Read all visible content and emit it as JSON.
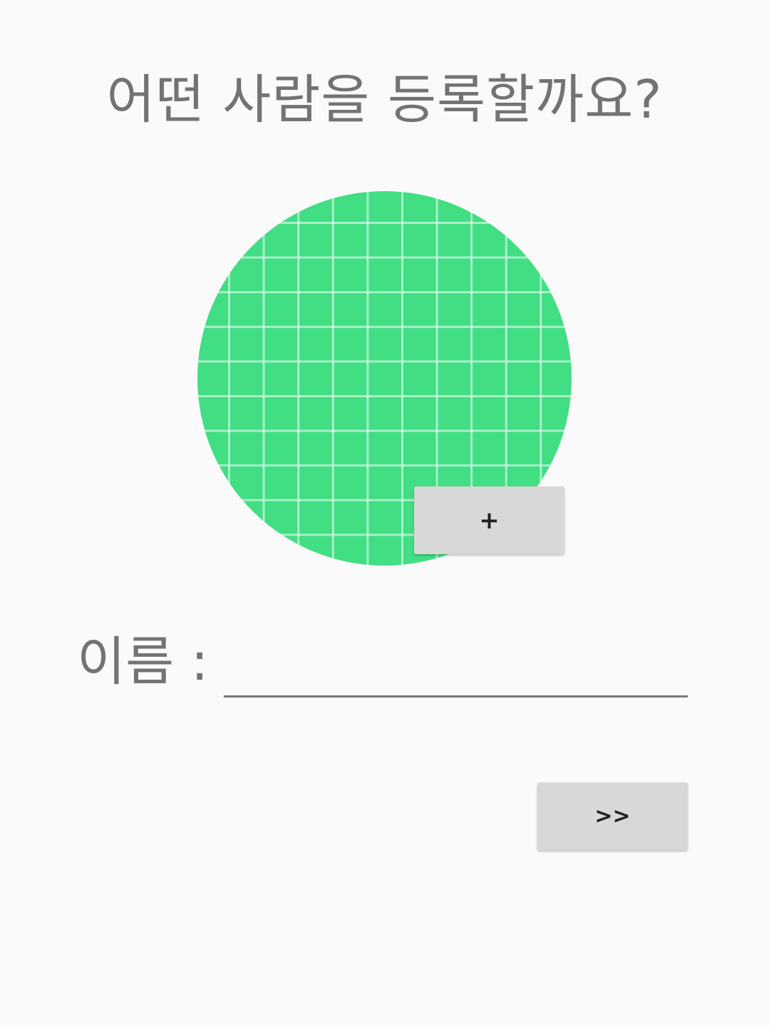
{
  "page": {
    "title": "어떤 사람을 등록할까요?"
  },
  "avatar": {
    "icon": "placeholder-grid-image",
    "color": "#41de84"
  },
  "add_photo_button": {
    "label": "+"
  },
  "form": {
    "name_label": "이름 :",
    "name_value": "",
    "name_placeholder": ""
  },
  "next_button": {
    "label": ">>"
  }
}
